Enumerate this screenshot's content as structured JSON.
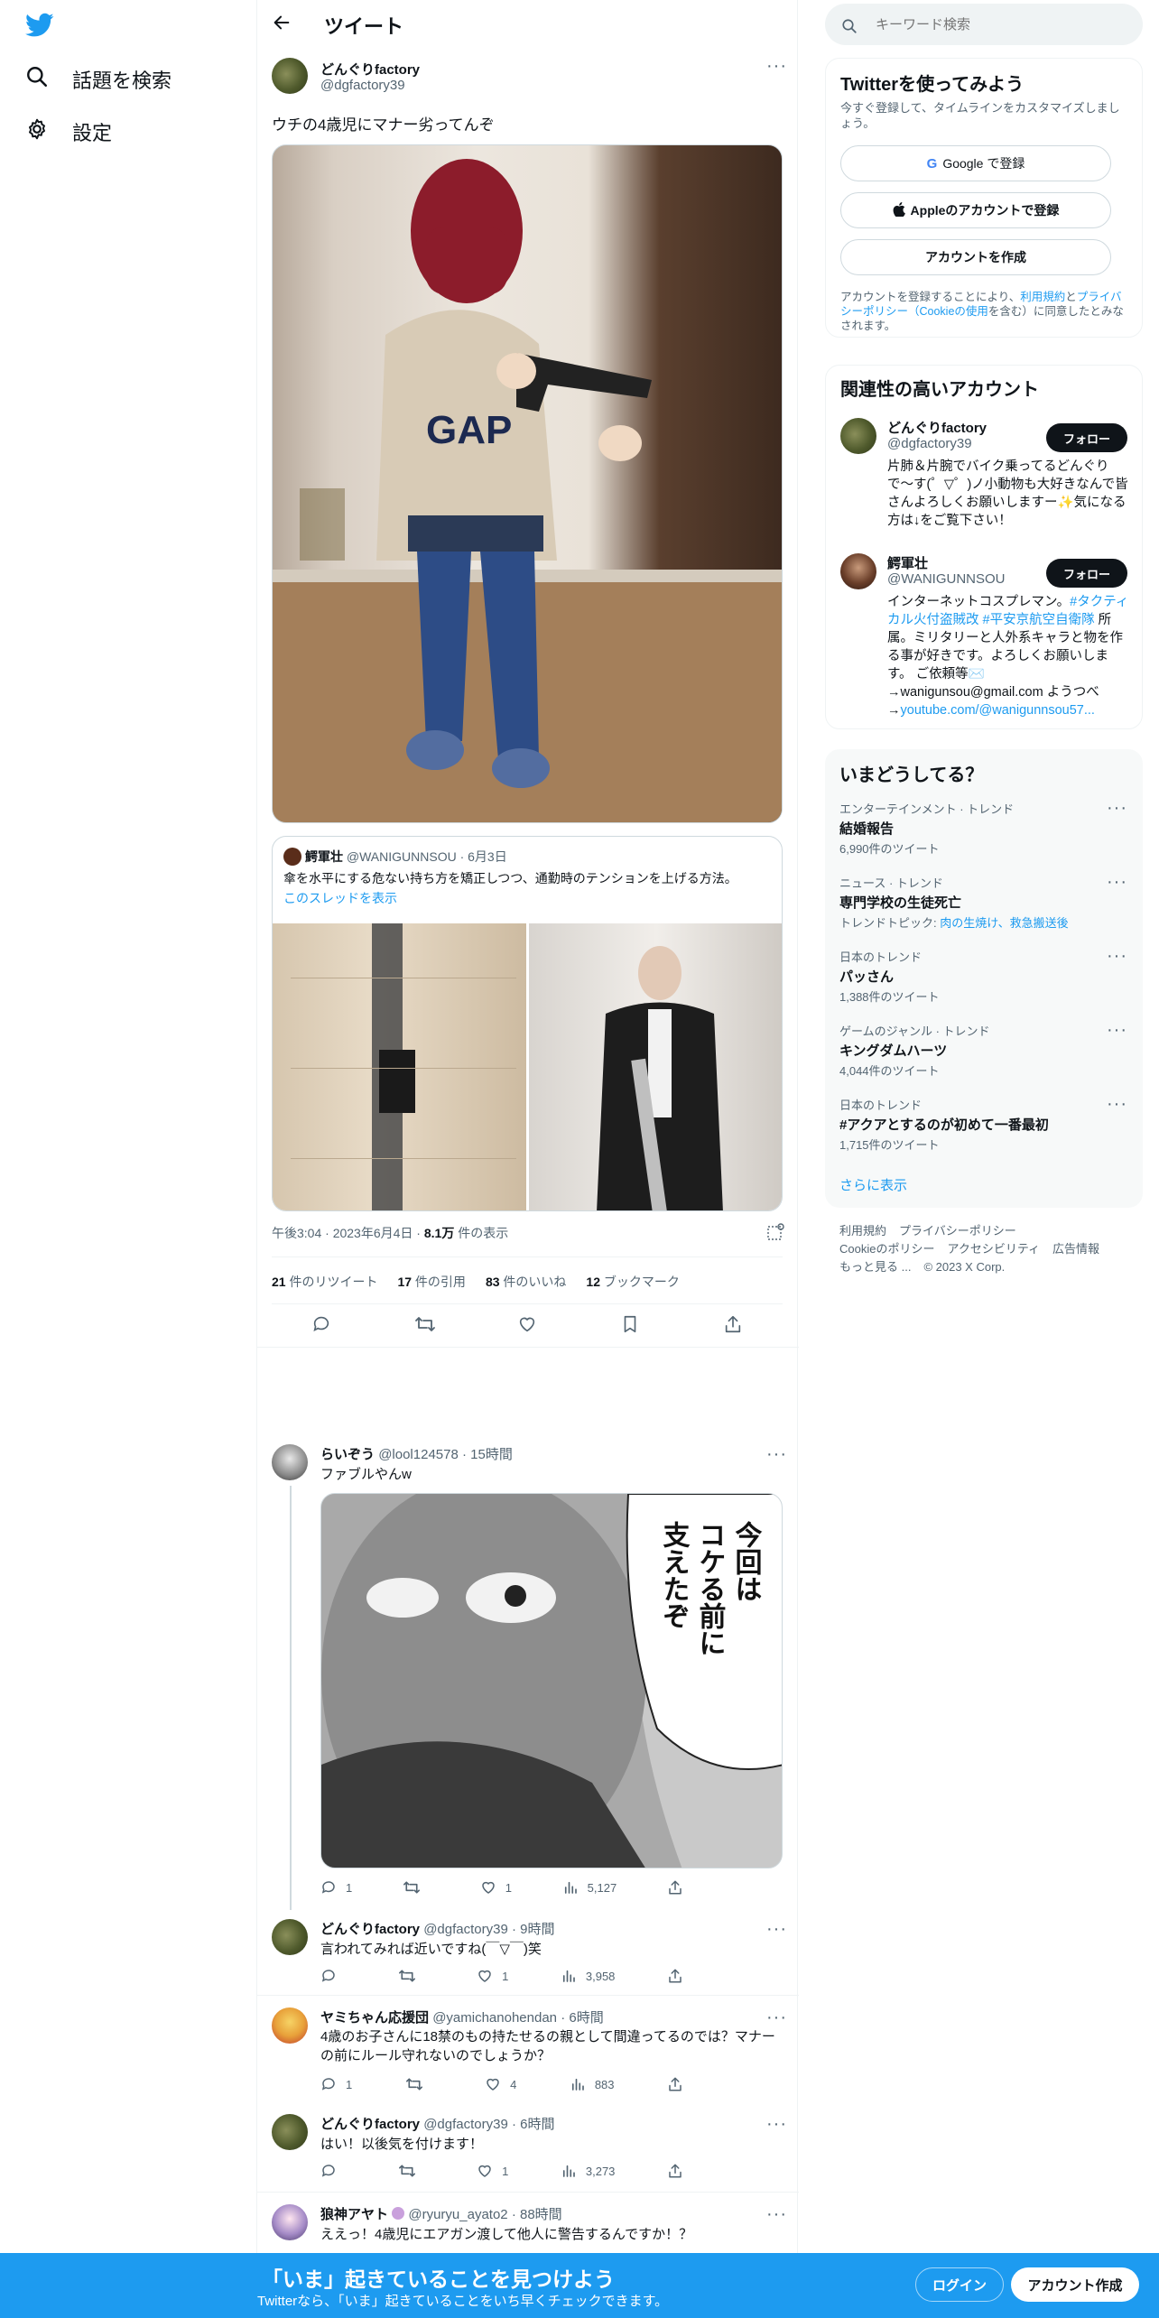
{
  "nav": {
    "explore_label": "話題を検索",
    "settings_label": "設定"
  },
  "header": {
    "title": "ツイート"
  },
  "tweet": {
    "author_name": "どんぐりfactory",
    "author_handle": "@dgfactory39",
    "text": "ウチの4歳児にマナー劣ってんぞ",
    "quote": {
      "author_name": "鰐軍壮",
      "author_handle": "@WANIGUNNSOU",
      "date": "· 6月3日",
      "text": "傘を水平にする危ない持ち方を矯正しつつ、通勤時のテンションを上げる方法。",
      "thread_link": "このスレッドを表示"
    },
    "time": "午後3:04 · 2023年6月4日 · ",
    "views_count": "8.1万",
    "views_label": " 件の表示",
    "retweets_count": "21",
    "retweets_label": " 件のリツイート",
    "quotes_count": "17",
    "quotes_label": " 件の引用",
    "likes_count": "83",
    "likes_label": " 件のいいね",
    "bookmarks_count": "12",
    "bookmarks_label": " ブックマーク"
  },
  "replies": [
    {
      "name": "らいぞう",
      "handle": "@lool124578",
      "time": "· 15時間",
      "text": "ファブルやんw",
      "replies": "1",
      "retweets": "",
      "likes": "1",
      "views": "5,127"
    },
    {
      "name": "どんぐりfactory",
      "handle": "@dgfactory39",
      "time": "· 9時間",
      "text": "言われてみれば近いですね(￣▽￣)笑",
      "replies": "",
      "retweets": "",
      "likes": "1",
      "views": "3,958"
    },
    {
      "name": "ヤミちゃん応援団",
      "handle": "@yamichanohendan",
      "time": "· 6時間",
      "text": "4歳のお子さんに18禁のもの持たせるの親として間違ってるのでは？マナーの前にルール守れないのでしょうか？",
      "replies": "1",
      "retweets": "",
      "likes": "4",
      "views": "883"
    },
    {
      "name": "どんぐりfactory",
      "handle": "@dgfactory39",
      "time": "· 6時間",
      "text": "はい！以後気を付けます！",
      "replies": "",
      "retweets": "",
      "likes": "1",
      "views": "3,273"
    },
    {
      "name": "狼神アヤト",
      "handle": "@ryuryu_ayato2",
      "time": "· 88時間",
      "text": "ええっ！4歳児にエアガン渡して他人に警告するんですか！？"
    }
  ],
  "search": {
    "placeholder": "キーワード検索"
  },
  "signup": {
    "title": "Twitterを使ってみよう",
    "subtitle": "今すぐ登録して、タイムラインをカスタマイズしましょう。",
    "google_label": "Google で登録",
    "apple_label": "Appleのアカウントで登録",
    "create_label": "アカウントを作成",
    "terms_prefix": "アカウントを登録することにより、",
    "terms_link": "利用規約",
    "terms_and": "と",
    "privacy_link": "プライバシーポリシー（Cookieの使用",
    "terms_suffix": "を含む）に同意したとみなされます。"
  },
  "related": {
    "title": "関連性の高いアカウント",
    "accounts": [
      {
        "name": "どんぐりfactory",
        "handle": "@dgfactory39",
        "follow": "フォロー",
        "bio": "片肺＆片腕でバイク乗ってるどんぐりで〜す(゜▽゜)ノ小動物も大好きなんで皆さんよろしくお願いしますー✨気になる方は↓をご覧下さい！"
      },
      {
        "name": "鰐軍壮",
        "handle": "@WANIGUNNSOU",
        "follow": "フォロー",
        "bio_1": "インターネットコスプレマン。",
        "bio_link1": "#タクティカル火付盗賊改",
        "bio_link2": "#平安京航空自衛隊",
        "bio_2": " 所属。ミリタリーと人外系キャラと物を作る事が好きです。よろしくお願いします。 ご依頼等✉️→wanigunsou@gmail.com ようつべ→",
        "bio_link3": "youtube.com/@wanigunnsou57..."
      }
    ]
  },
  "trends": {
    "title": "いまどうしてる？",
    "items": [
      {
        "meta": "エンターテインメント · トレンド",
        "name": "結婚報告",
        "count": "6,990件のツイート"
      },
      {
        "meta": "ニュース · トレンド",
        "name": "専門学校の生徒死亡",
        "count_prefix": "トレンドトピック: ",
        "count_link": "肉の生焼け、救急搬送後"
      },
      {
        "meta": "日本のトレンド",
        "name": "パッさん",
        "count": "1,388件のツイート"
      },
      {
        "meta": "ゲームのジャンル · トレンド",
        "name": "キングダムハーツ",
        "count": "4,044件のツイート"
      },
      {
        "meta": "日本のトレンド",
        "name": "#アクアとするのが初めて一番最初",
        "count": "1,715件のツイート"
      }
    ],
    "more": "さらに表示"
  },
  "footer": {
    "links_row1": [
      "利用規約",
      "プライバシーポリシー"
    ],
    "links_row2": [
      "Cookieのポリシー",
      "アクセシビリティ",
      "広告情報"
    ],
    "more": "もっと見る ...",
    "copyright": "© 2023 X Corp."
  },
  "banner": {
    "title": "「いま」起きていることを見つけよう",
    "subtitle": "Twitterなら、「いま」起きていることをいち早くチェックできます。",
    "login": "ログイン",
    "signup": "アカウント作成"
  },
  "colors": {
    "accent": "#1d9bf0",
    "text": "#0f1419",
    "muted": "#536471"
  }
}
